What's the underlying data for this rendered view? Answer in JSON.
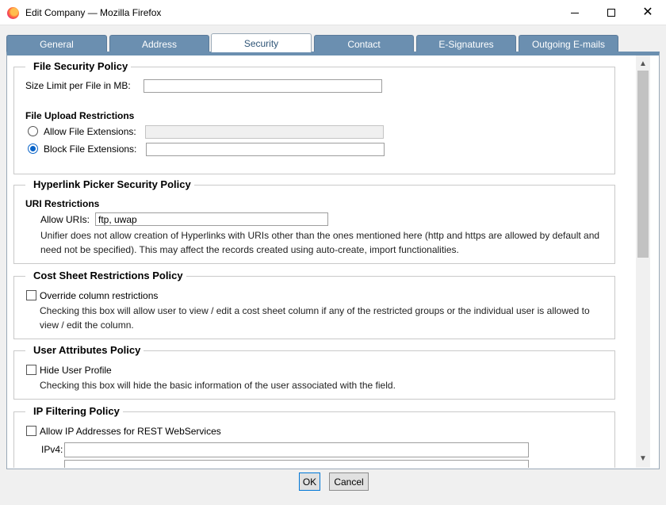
{
  "window": {
    "title": "Edit Company — Mozilla Firefox",
    "icon": "firefox-icon"
  },
  "tabs": [
    {
      "label": "General"
    },
    {
      "label": "Address"
    },
    {
      "label": "Security",
      "active": true
    },
    {
      "label": "Contact"
    },
    {
      "label": "E-Signatures"
    },
    {
      "label": "Outgoing E-mails"
    }
  ],
  "file_security": {
    "legend": "File Security Policy",
    "size_limit_label": "Size Limit per File in MB:",
    "size_limit_value": "",
    "restrictions_title": "File Upload Restrictions",
    "allow_label": "Allow File Extensions:",
    "allow_value": "",
    "block_label": "Block File Extensions:",
    "block_value": "",
    "selected": "block"
  },
  "hyperlink": {
    "legend": "Hyperlink Picker Security Policy",
    "section_title": "URI Restrictions",
    "allow_uris_label": "Allow URIs:",
    "allow_uris_value": "ftp, uwap",
    "note": "Unifier does not allow creation of Hyperlinks with URIs other than the ones mentioned here (http and https are allowed by default and need not be specified). This may affect the records created using auto-create, import functionalities."
  },
  "cost_sheet": {
    "legend": "Cost Sheet Restrictions Policy",
    "checkbox_label": "Override column restrictions",
    "checked": false,
    "note": "Checking this box will allow user to view / edit a cost sheet column if any of the restricted groups or the individual user is allowed to view / edit the column."
  },
  "user_attributes": {
    "legend": "User Attributes Policy",
    "checkbox_label": "Hide User Profile",
    "checked": false,
    "note": "Checking this box will hide the basic information of the user associated with the field."
  },
  "ip_filtering": {
    "legend": "IP Filtering Policy",
    "checkbox_label": "Allow IP Addresses for REST WebServices",
    "checked": false,
    "ipv4_label": "IPv4:",
    "ipv4_value": ""
  },
  "footer": {
    "ok_label": "OK",
    "cancel_label": "Cancel"
  },
  "colors": {
    "tab_bg": "#6b8fb0",
    "active_tab_text": "#2f5577",
    "radio_accent": "#0a64c8"
  }
}
